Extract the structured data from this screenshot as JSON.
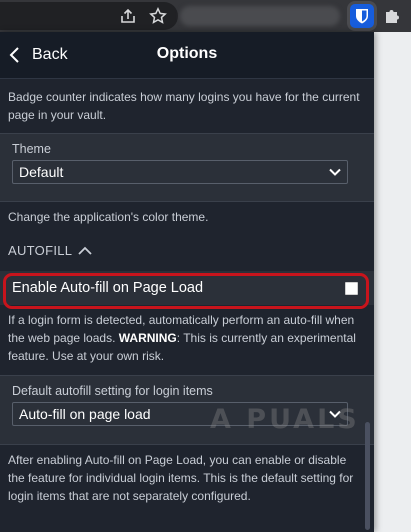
{
  "popup": {
    "header": {
      "back_label": "Back",
      "title": "Options"
    },
    "badge_desc": "Badge counter indicates how many logins you have for the current page in your vault.",
    "theme": {
      "label": "Theme",
      "value": "Default",
      "description": "Change the application's color theme."
    },
    "autofill_section": {
      "heading": "AUTOFILL"
    },
    "autofill_on_load": {
      "label": "Enable Auto-fill on Page Load",
      "checked": false,
      "description_part1": "If a login form is detected, automatically perform an auto-fill when the web page loads. ",
      "warning": "WARNING",
      "description_part2": ": This is currently an experimental feature. Use at your own risk."
    },
    "default_autofill": {
      "label": "Default autofill setting for login items",
      "value": "Auto-fill on page load",
      "description": "After enabling Auto-fill on Page Load, you can enable or disable the feature for individual login items. This is the default setting for login items that are not separately configured."
    }
  },
  "watermark": "A PUALS",
  "colors": {
    "popup_bg": "#1f242e",
    "box_bg": "#2b3039",
    "highlight": "#c8141c",
    "bitwarden_blue": "#175ddc"
  },
  "icons": [
    "share-icon",
    "star-icon",
    "bitwarden-icon",
    "extensions-puzzle-icon",
    "chevron-left-icon",
    "chevron-up-icon",
    "dropdown-caret-icon"
  ]
}
